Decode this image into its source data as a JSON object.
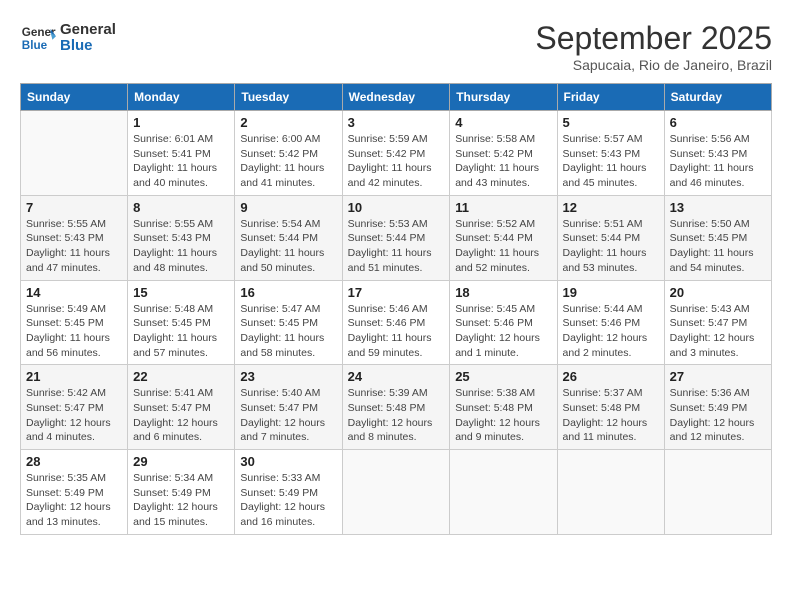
{
  "header": {
    "logo_general": "General",
    "logo_blue": "Blue",
    "month": "September 2025",
    "location": "Sapucaia, Rio de Janeiro, Brazil"
  },
  "days_of_week": [
    "Sunday",
    "Monday",
    "Tuesday",
    "Wednesday",
    "Thursday",
    "Friday",
    "Saturday"
  ],
  "weeks": [
    [
      {
        "num": "",
        "info": ""
      },
      {
        "num": "1",
        "info": "Sunrise: 6:01 AM\nSunset: 5:41 PM\nDaylight: 11 hours\nand 40 minutes."
      },
      {
        "num": "2",
        "info": "Sunrise: 6:00 AM\nSunset: 5:42 PM\nDaylight: 11 hours\nand 41 minutes."
      },
      {
        "num": "3",
        "info": "Sunrise: 5:59 AM\nSunset: 5:42 PM\nDaylight: 11 hours\nand 42 minutes."
      },
      {
        "num": "4",
        "info": "Sunrise: 5:58 AM\nSunset: 5:42 PM\nDaylight: 11 hours\nand 43 minutes."
      },
      {
        "num": "5",
        "info": "Sunrise: 5:57 AM\nSunset: 5:43 PM\nDaylight: 11 hours\nand 45 minutes."
      },
      {
        "num": "6",
        "info": "Sunrise: 5:56 AM\nSunset: 5:43 PM\nDaylight: 11 hours\nand 46 minutes."
      }
    ],
    [
      {
        "num": "7",
        "info": "Sunrise: 5:55 AM\nSunset: 5:43 PM\nDaylight: 11 hours\nand 47 minutes."
      },
      {
        "num": "8",
        "info": "Sunrise: 5:55 AM\nSunset: 5:43 PM\nDaylight: 11 hours\nand 48 minutes."
      },
      {
        "num": "9",
        "info": "Sunrise: 5:54 AM\nSunset: 5:44 PM\nDaylight: 11 hours\nand 50 minutes."
      },
      {
        "num": "10",
        "info": "Sunrise: 5:53 AM\nSunset: 5:44 PM\nDaylight: 11 hours\nand 51 minutes."
      },
      {
        "num": "11",
        "info": "Sunrise: 5:52 AM\nSunset: 5:44 PM\nDaylight: 11 hours\nand 52 minutes."
      },
      {
        "num": "12",
        "info": "Sunrise: 5:51 AM\nSunset: 5:44 PM\nDaylight: 11 hours\nand 53 minutes."
      },
      {
        "num": "13",
        "info": "Sunrise: 5:50 AM\nSunset: 5:45 PM\nDaylight: 11 hours\nand 54 minutes."
      }
    ],
    [
      {
        "num": "14",
        "info": "Sunrise: 5:49 AM\nSunset: 5:45 PM\nDaylight: 11 hours\nand 56 minutes."
      },
      {
        "num": "15",
        "info": "Sunrise: 5:48 AM\nSunset: 5:45 PM\nDaylight: 11 hours\nand 57 minutes."
      },
      {
        "num": "16",
        "info": "Sunrise: 5:47 AM\nSunset: 5:45 PM\nDaylight: 11 hours\nand 58 minutes."
      },
      {
        "num": "17",
        "info": "Sunrise: 5:46 AM\nSunset: 5:46 PM\nDaylight: 11 hours\nand 59 minutes."
      },
      {
        "num": "18",
        "info": "Sunrise: 5:45 AM\nSunset: 5:46 PM\nDaylight: 12 hours\nand 1 minute."
      },
      {
        "num": "19",
        "info": "Sunrise: 5:44 AM\nSunset: 5:46 PM\nDaylight: 12 hours\nand 2 minutes."
      },
      {
        "num": "20",
        "info": "Sunrise: 5:43 AM\nSunset: 5:47 PM\nDaylight: 12 hours\nand 3 minutes."
      }
    ],
    [
      {
        "num": "21",
        "info": "Sunrise: 5:42 AM\nSunset: 5:47 PM\nDaylight: 12 hours\nand 4 minutes."
      },
      {
        "num": "22",
        "info": "Sunrise: 5:41 AM\nSunset: 5:47 PM\nDaylight: 12 hours\nand 6 minutes."
      },
      {
        "num": "23",
        "info": "Sunrise: 5:40 AM\nSunset: 5:47 PM\nDaylight: 12 hours\nand 7 minutes."
      },
      {
        "num": "24",
        "info": "Sunrise: 5:39 AM\nSunset: 5:48 PM\nDaylight: 12 hours\nand 8 minutes."
      },
      {
        "num": "25",
        "info": "Sunrise: 5:38 AM\nSunset: 5:48 PM\nDaylight: 12 hours\nand 9 minutes."
      },
      {
        "num": "26",
        "info": "Sunrise: 5:37 AM\nSunset: 5:48 PM\nDaylight: 12 hours\nand 11 minutes."
      },
      {
        "num": "27",
        "info": "Sunrise: 5:36 AM\nSunset: 5:49 PM\nDaylight: 12 hours\nand 12 minutes."
      }
    ],
    [
      {
        "num": "28",
        "info": "Sunrise: 5:35 AM\nSunset: 5:49 PM\nDaylight: 12 hours\nand 13 minutes."
      },
      {
        "num": "29",
        "info": "Sunrise: 5:34 AM\nSunset: 5:49 PM\nDaylight: 12 hours\nand 15 minutes."
      },
      {
        "num": "30",
        "info": "Sunrise: 5:33 AM\nSunset: 5:49 PM\nDaylight: 12 hours\nand 16 minutes."
      },
      {
        "num": "",
        "info": ""
      },
      {
        "num": "",
        "info": ""
      },
      {
        "num": "",
        "info": ""
      },
      {
        "num": "",
        "info": ""
      }
    ]
  ]
}
